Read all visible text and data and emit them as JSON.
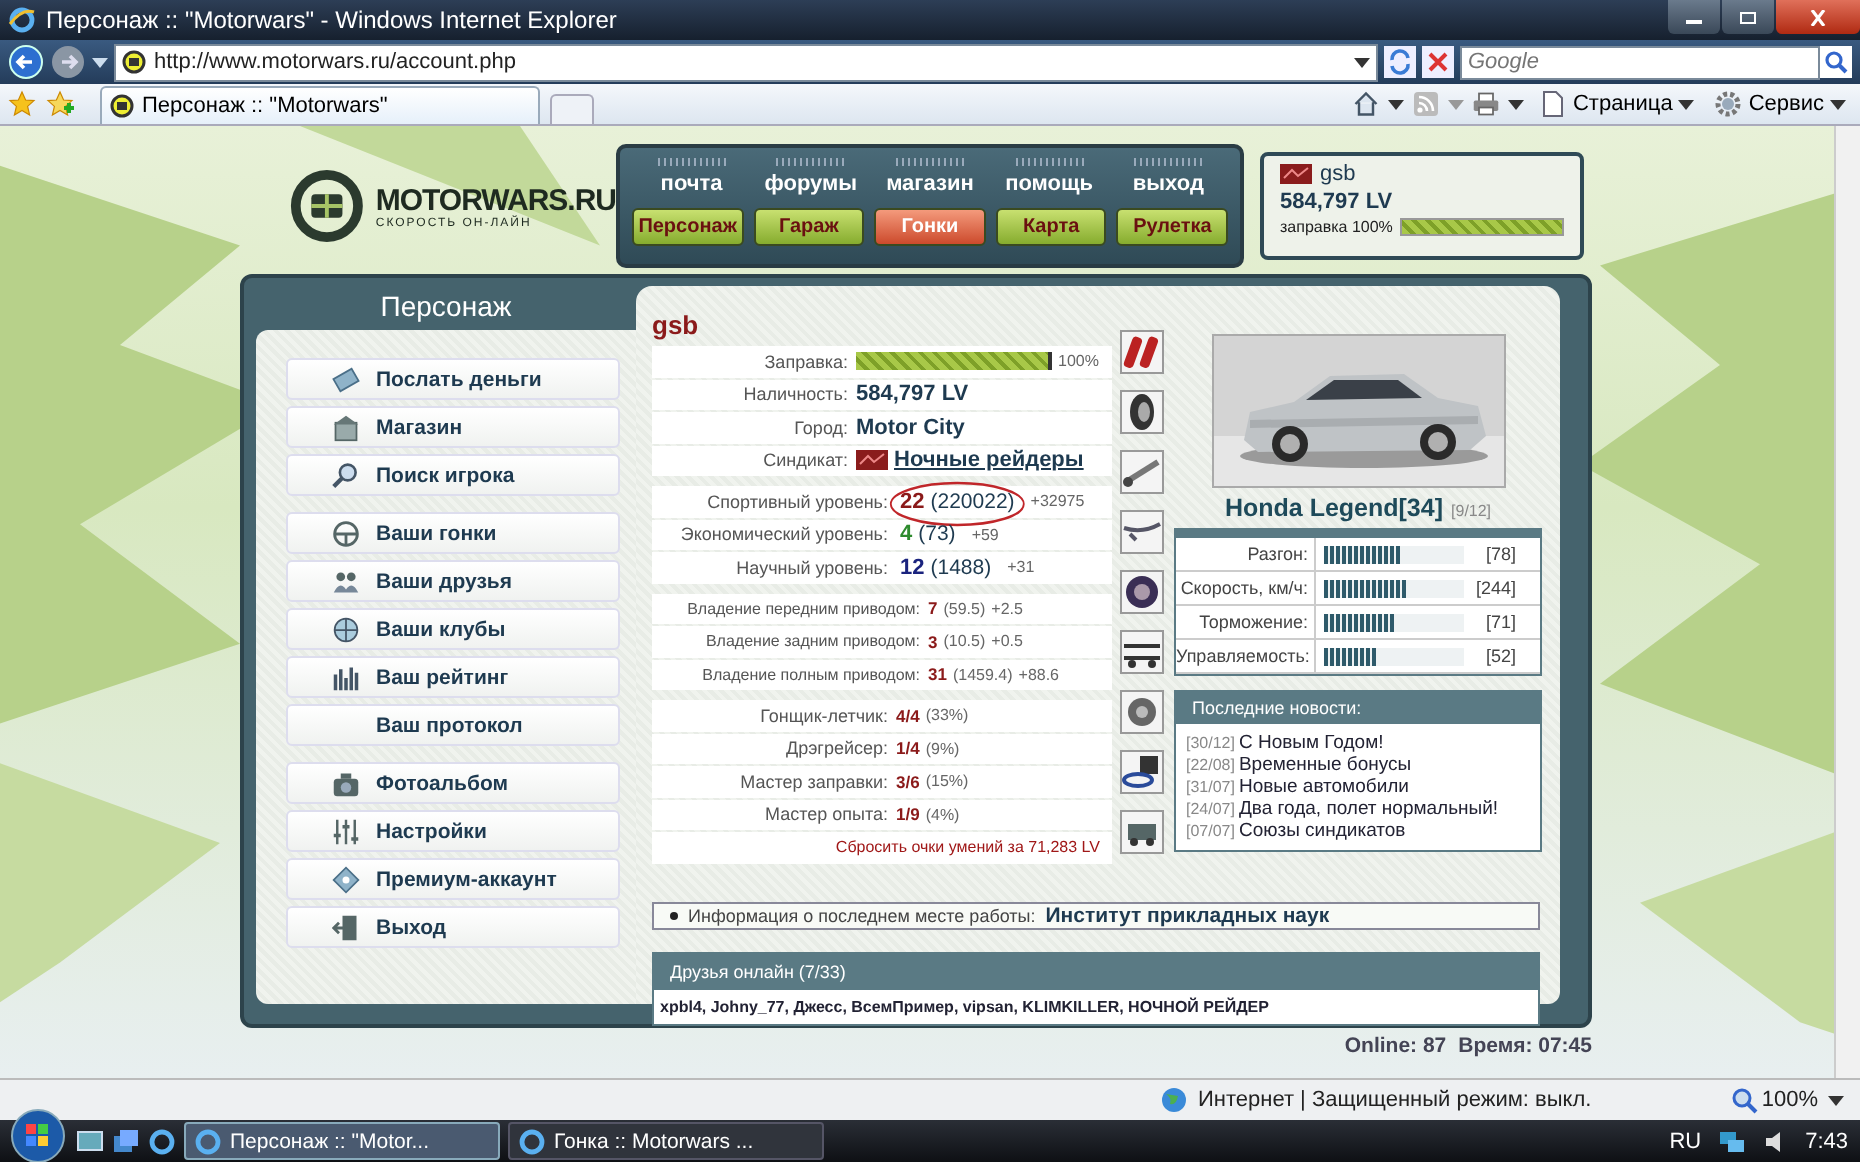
{
  "browser": {
    "title": "Персонаж :: \"Motorwars\" - Windows Internet Explorer",
    "url": "http://www.motorwars.ru/account.php",
    "search": {
      "placeholder": "Google"
    },
    "tab_title": "Персонаж :: \"Motorwars\"",
    "tools": [
      "Страница",
      "Сервис"
    ],
    "status": "Интернет | Защищенный режим: выкл.",
    "zoom": "100%"
  },
  "site": {
    "logo": {
      "name": "MOTORWARS.RU",
      "tagline": "СКОРОСТЬ ОН-ЛАЙН"
    },
    "top_links": [
      "почта",
      "форумы",
      "магазин",
      "помощь",
      "выход"
    ],
    "main_nav": [
      {
        "label": "Персонаж",
        "selected": false
      },
      {
        "label": "Гараж",
        "selected": false
      },
      {
        "label": "Гонки",
        "selected": true
      },
      {
        "label": "Карта",
        "selected": false
      },
      {
        "label": "Рулетка",
        "selected": false
      }
    ],
    "user": {
      "name": "gsb",
      "money": "584,797 LV",
      "fuel_label": "заправка 100%",
      "level": 1
    },
    "sidebar": {
      "title": "Персонаж",
      "groups": [
        {
          "items": [
            {
              "label": "Послать деньги",
              "icon": true
            },
            {
              "label": "Магазин",
              "icon": true
            },
            {
              "label": "Поиск игрока",
              "icon": true
            }
          ]
        },
        {
          "items": [
            {
              "label": "Ваши гонки",
              "icon": true
            },
            {
              "label": "Ваши друзья",
              "icon": true
            },
            {
              "label": "Ваши клубы",
              "icon": true
            },
            {
              "label": "Ваш рейтинг",
              "icon": true
            },
            {
              "label": "Ваш протокол",
              "icon": false
            }
          ]
        },
        {
          "items": [
            {
              "label": "Фотоальбом",
              "icon": true
            },
            {
              "label": "Настройки",
              "icon": true
            },
            {
              "label": "Премиум-аккаунт",
              "icon": true
            },
            {
              "label": "Выход",
              "icon": true
            }
          ]
        }
      ]
    },
    "profile": {
      "name": "gsb",
      "fuel": {
        "label": "Заправка:",
        "level": 1,
        "reading": "100%"
      },
      "rows": [
        {
          "kind": "text",
          "label": "Наличность:",
          "value": "584,797 LV"
        },
        {
          "kind": "text",
          "label": "Город:",
          "value": "Motor City"
        },
        {
          "kind": "link",
          "label": "Синдикат:",
          "value": "Ночные рейдеры"
        }
      ],
      "levels": [
        {
          "label": "Спортивный уровень:",
          "value": "22",
          "total": "(220022)",
          "delta": "+32975",
          "color": "#8b1a1a",
          "circled": true
        },
        {
          "label": "Экономический уровень:",
          "value": "4",
          "total": "(73)",
          "delta": "+59",
          "color": "#2e8b2e",
          "circled": false
        },
        {
          "label": "Научный уровень:",
          "value": "12",
          "total": "(1488)",
          "delta": "+31",
          "color": "#1a237e",
          "circled": false
        }
      ],
      "drives": [
        {
          "label": "Владение передним приводом:",
          "value": "7",
          "total": "(59.5)",
          "delta": "+2.5"
        },
        {
          "label": "Владение задним приводом:",
          "value": "3",
          "total": "(10.5)",
          "delta": "+0.5"
        },
        {
          "label": "Владение полным приводом:",
          "value": "31",
          "total": "(1459.4)",
          "delta": "+88.6"
        }
      ],
      "skills": [
        {
          "label": "Гонщик-летчик:",
          "value": "4/4",
          "share": "(33%)"
        },
        {
          "label": "Дрэгрейсер:",
          "value": "1/4",
          "share": "(9%)"
        },
        {
          "label": "Мастер заправки:",
          "value": "3/6",
          "share": "(15%)"
        },
        {
          "label": "Мастер опыта:",
          "value": "1/9",
          "share": "(4%)"
        }
      ],
      "reset": "Сбросить очки умений за 71,283 LV"
    },
    "car": {
      "name": "Honda Legend[34]",
      "slots": "[9/12]",
      "stats": [
        {
          "label": "Разгон:",
          "level": 0.55,
          "reading": "[78]"
        },
        {
          "label": "Скорость, км/ч:",
          "level": 0.59,
          "reading": "[244]"
        },
        {
          "label": "Торможение:",
          "level": 0.5,
          "reading": "[71]"
        },
        {
          "label": "Управляемость:",
          "level": 0.37,
          "reading": "[52]"
        }
      ]
    },
    "news": {
      "title": "Последние новости:",
      "items": [
        {
          "date": "[30/12]",
          "text": "С Новым Годом!"
        },
        {
          "date": "[22/08]",
          "text": "Временные бонусы"
        },
        {
          "date": "[31/07]",
          "text": "Новые автомобили"
        },
        {
          "date": "[24/07]",
          "text": "Два года, полет нормальный!"
        },
        {
          "date": "[07/07]",
          "text": "Союзы синдикатов"
        }
      ]
    },
    "work": {
      "label": "Информация о последнем месте работы:",
      "value": "Институт прикладных наук"
    },
    "friends": {
      "title": "Друзья онлайн (7/33)",
      "names": "xpbl4, Johny_77, Джесс, ВсемПример, vipsan, KLIMKILLER, НОЧНОЙ РЕЙДЕР"
    },
    "footer": {
      "online": "Online: 87",
      "time": "Время: 07:45"
    }
  },
  "taskbar": {
    "tasks": [
      {
        "label": "Персонаж :: \"Motor...",
        "selected": true
      },
      {
        "label": "Гонка :: Motorwars ...",
        "selected": false
      }
    ],
    "lang": "RU",
    "clock": "7:43"
  }
}
